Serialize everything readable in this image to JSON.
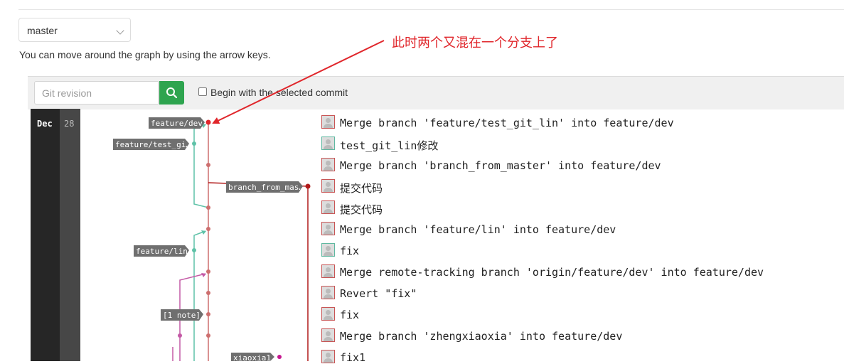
{
  "branch_select": {
    "value": "master"
  },
  "hint": "You can move around the graph by using the arrow keys.",
  "annotation": "此时两个又混在一个分支上了",
  "toolbar": {
    "revision_placeholder": "Git revision",
    "begin_label": "Begin with the selected commit"
  },
  "date": {
    "month": "Dec",
    "day": "28"
  },
  "refs": {
    "feature_dev": "feature/dev",
    "feature_test_gi": "feature/test_gi…",
    "branch_from_mas": "branch_from_mas…",
    "feature_lin": "feature/lin",
    "note": "[1 note]",
    "xiaoxia1": "xiaoxia1"
  },
  "commits": [
    {
      "message": "Merge branch 'feature/test_git_lin' into feature/dev"
    },
    {
      "message": "test_git_lin修改"
    },
    {
      "message": "Merge branch 'branch_from_master' into feature/dev"
    },
    {
      "message": "提交代码"
    },
    {
      "message": "提交代码"
    },
    {
      "message": "Merge branch 'feature/lin' into feature/dev"
    },
    {
      "message": "fix"
    },
    {
      "message": "Merge remote-tracking branch 'origin/feature/dev' into feature/dev"
    },
    {
      "message": "Revert \"fix\""
    },
    {
      "message": "fix"
    },
    {
      "message": "Merge branch 'zhengxiaoxia' into feature/dev"
    },
    {
      "message": "fix1"
    }
  ],
  "colors": {
    "accent_red": "#e0262b",
    "main_line": "#cd6f6f",
    "teal": "#5fc2a8",
    "pink": "#c45aa6",
    "dark_red": "#b11a1a",
    "search_green": "#2ea44f"
  },
  "icons": {
    "search": "search-icon",
    "avatar": "avatar-icon",
    "chevron": "chevron-down-icon"
  }
}
